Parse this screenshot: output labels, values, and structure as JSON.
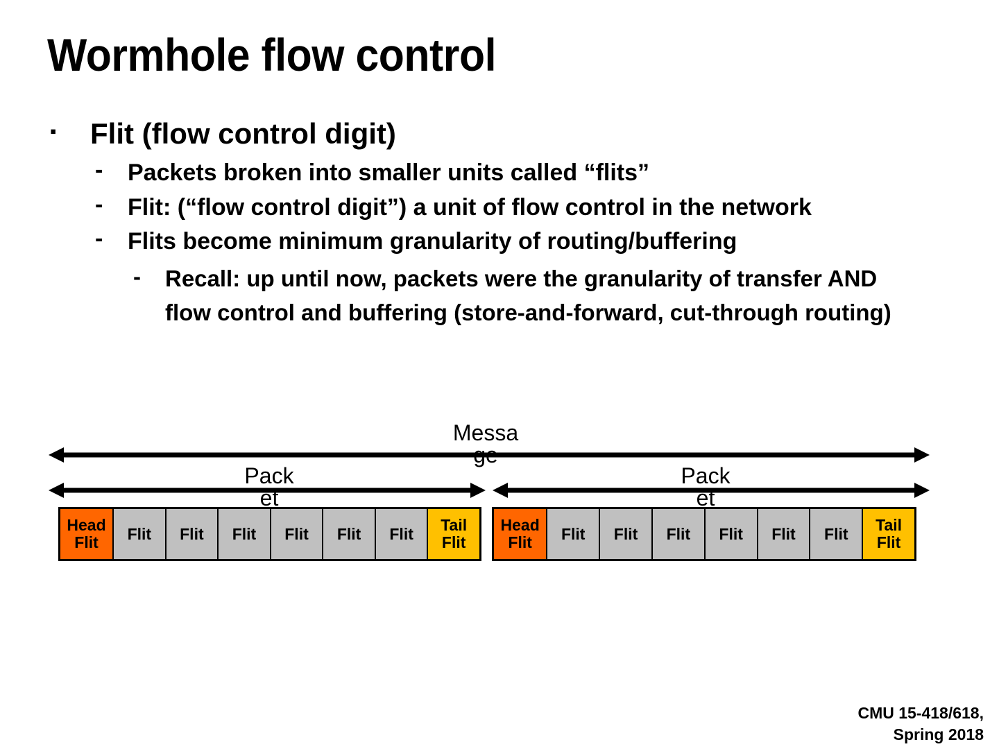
{
  "slide": {
    "title": "Wormhole flow control"
  },
  "bullets": {
    "level1_marker": "▪",
    "level2_marker": "-",
    "level3_marker": "-",
    "main": "Flit (flow control digit)",
    "sub": [
      "Packets broken into smaller units called “flits”",
      "Flit: (“flow control digit”) a unit of flow control in the network",
      "Flits become minimum granularity of routing/buffering"
    ],
    "subsub": "Recall: up until now, packets were the granularity of transfer AND flow control and buffering (store-and-forward, cut-through routing)"
  },
  "diagram": {
    "message_label_line1": "Messa",
    "message_label_line2": "ge",
    "packet_label_line1": "Pack",
    "packet_label_line2": "et",
    "colors": {
      "head": "#ff6600",
      "tail": "#ffc000",
      "flit": "#c0c0c0",
      "border": "#000000"
    },
    "packets": [
      {
        "flits": [
          {
            "line1": "Head",
            "line2": "Flit",
            "kind": "head"
          },
          {
            "line1": "Flit",
            "line2": "",
            "kind": "body"
          },
          {
            "line1": "Flit",
            "line2": "",
            "kind": "body"
          },
          {
            "line1": "Flit",
            "line2": "",
            "kind": "body"
          },
          {
            "line1": "Flit",
            "line2": "",
            "kind": "body"
          },
          {
            "line1": "Flit",
            "line2": "",
            "kind": "body"
          },
          {
            "line1": "Flit",
            "line2": "",
            "kind": "body"
          },
          {
            "line1": "Tail",
            "line2": "Flit",
            "kind": "tail"
          }
        ]
      },
      {
        "flits": [
          {
            "line1": "Head",
            "line2": "Flit",
            "kind": "head"
          },
          {
            "line1": "Flit",
            "line2": "",
            "kind": "body"
          },
          {
            "line1": "Flit",
            "line2": "",
            "kind": "body"
          },
          {
            "line1": "Flit",
            "line2": "",
            "kind": "body"
          },
          {
            "line1": "Flit",
            "line2": "",
            "kind": "body"
          },
          {
            "line1": "Flit",
            "line2": "",
            "kind": "body"
          },
          {
            "line1": "Flit",
            "line2": "",
            "kind": "body"
          },
          {
            "line1": "Tail",
            "line2": "Flit",
            "kind": "tail"
          }
        ]
      }
    ]
  },
  "footer": {
    "line1": "CMU 15-418/618,",
    "line2": "Spring 2018"
  }
}
